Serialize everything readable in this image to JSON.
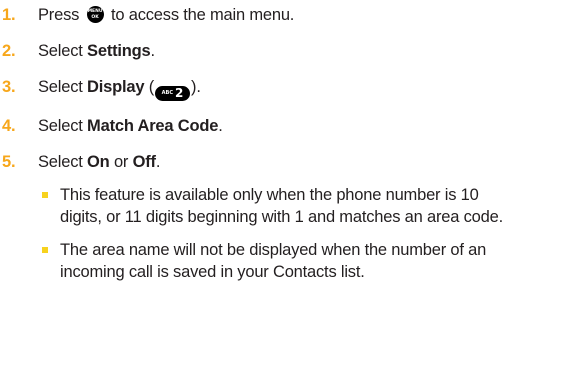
{
  "steps": [
    {
      "number": "1.",
      "before": "Press",
      "key": {
        "top": "MENU",
        "bottom": "OK"
      },
      "after": "to access the main menu."
    },
    {
      "number": "2.",
      "before": "Select ",
      "bold": "Settings",
      "after": "."
    },
    {
      "number": "3.",
      "before": "Select ",
      "bold": "Display",
      "open": " (",
      "key": {
        "small": "ABC",
        "big": "2"
      },
      "close": ")."
    },
    {
      "number": "4.",
      "before": "Select ",
      "bold": "Match Area Code",
      "after": "."
    },
    {
      "number": "5.",
      "before": "Select ",
      "bold": "On",
      "middle": " or ",
      "bold2": "Off",
      "after": ".",
      "bullets": [
        "This feature is available only when the phone number is 10 digits, or 11 digits beginning with 1 and matches an area code.",
        "The area name will not be displayed when the number of an incoming call is saved in your Contacts list."
      ]
    }
  ],
  "colors": {
    "step_number": "#f7a71b",
    "bullet": "#f7d21e",
    "text": "#231f20",
    "key_bg": "#000000"
  }
}
